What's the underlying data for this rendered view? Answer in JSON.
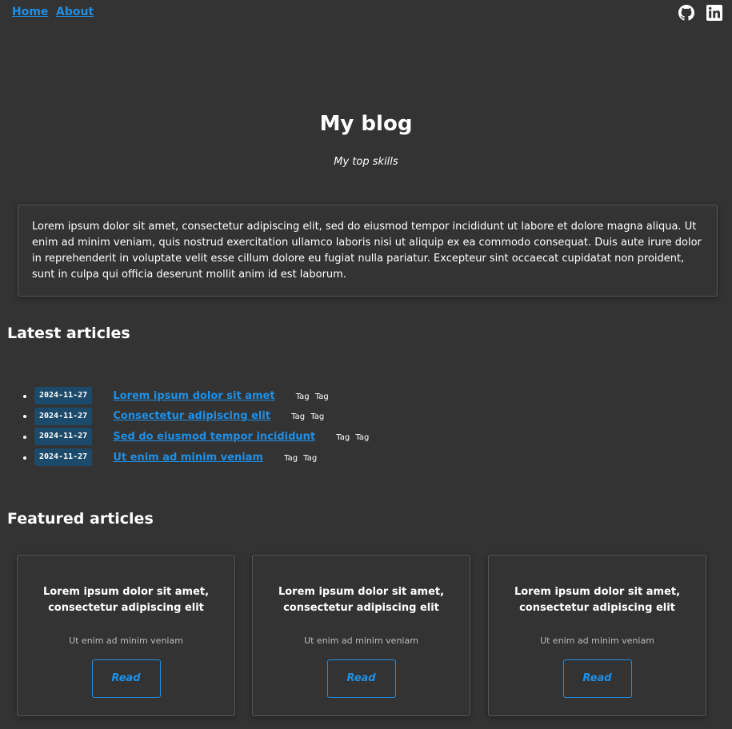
{
  "nav": {
    "home_label": "Home",
    "about_label": "About",
    "social_icons": [
      "github-icon",
      "linkedin-icon"
    ]
  },
  "hero": {
    "title": "My blog",
    "subtitle": "My top skills"
  },
  "intro_text": "Lorem ipsum dolor sit amet, consectetur adipiscing elit, sed do eiusmod tempor incididunt ut labore et dolore magna aliqua. Ut enim ad minim veniam, quis nostrud exercitation ullamco laboris nisi ut aliquip ex ea commodo consequat. Duis aute irure dolor in reprehenderit in voluptate velit esse cillum dolore eu fugiat nulla pariatur. Excepteur sint occaecat cupidatat non proident, sunt in culpa qui officia deserunt mollit anim id est laborum.",
  "latest": {
    "title": "Latest articles",
    "items": [
      {
        "date": "2024-11-27",
        "title": "Lorem ipsum dolor sit amet",
        "tags": [
          "Tag",
          "Tag"
        ]
      },
      {
        "date": "2024-11-27",
        "title": "Consectetur adipiscing elit",
        "tags": [
          "Tag",
          "Tag"
        ]
      },
      {
        "date": "2024-11-27",
        "title": "Sed do eiusmod tempor incididunt",
        "tags": [
          "Tag",
          "Tag"
        ]
      },
      {
        "date": "2024-11-27",
        "title": "Ut enim ad minim veniam",
        "tags": [
          "Tag",
          "Tag"
        ]
      }
    ]
  },
  "featured": {
    "title": "Featured articles",
    "cards": [
      {
        "title": "Lorem ipsum dolor sit amet, consectetur adipiscing elit",
        "subtitle": "Ut enim ad minim veniam",
        "button": "Read"
      },
      {
        "title": "Lorem ipsum dolor sit amet, consectetur adipiscing elit",
        "subtitle": "Ut enim ad minim veniam",
        "button": "Read"
      },
      {
        "title": "Lorem ipsum dolor sit amet, consectetur adipiscing elit",
        "subtitle": "Ut enim ad minim veniam",
        "button": "Read"
      }
    ]
  },
  "colors": {
    "background": "#333333",
    "link": "#1e8fe6",
    "badge": "#1c4a6b",
    "text": "#ffffff"
  }
}
